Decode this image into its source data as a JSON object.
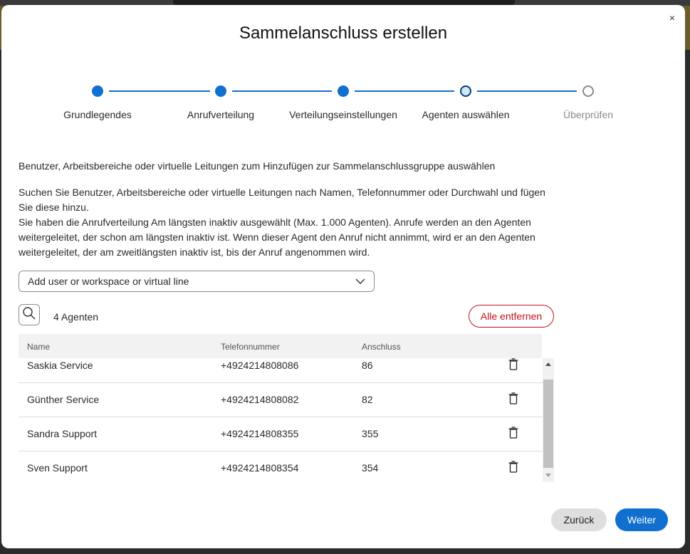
{
  "dialog": {
    "title": "Sammelanschluss erstellen",
    "close_glyph": "×"
  },
  "stepper": {
    "steps": [
      {
        "label": "Grundlegendes",
        "state": "done"
      },
      {
        "label": "Anrufverteilung",
        "state": "done"
      },
      {
        "label": "Verteilungseinstellungen",
        "state": "done"
      },
      {
        "label": "Agenten auswählen",
        "state": "current"
      },
      {
        "label": "Überprüfen",
        "state": "future"
      }
    ]
  },
  "content": {
    "intro": "Benutzer, Arbeitsbereiche oder virtuelle Leitungen zum Hinzufügen zur Sammelanschlussgruppe auswählen",
    "instructions_line1": "Suchen Sie Benutzer, Arbeitsbereiche oder virtuelle Leitungen nach Namen, Telefonnummer oder Durchwahl und fügen Sie diese hinzu.",
    "instructions_line2": "Sie haben die Anrufverteilung Am längsten inaktiv ausgewählt (Max. 1.000 Agenten). Anrufe werden an den Agenten weitergeleitet, der schon am längsten inaktiv ist. Wenn dieser Agent den Anruf nicht annimmt, wird er an den Agenten weitergeleitet, der am zweitlängsten inaktiv ist, bis der Anruf angenommen wird.",
    "dropdown_placeholder": "Add user or workspace or virtual line",
    "agent_count": "4 Agenten",
    "remove_all_label": "Alle entfernen"
  },
  "table": {
    "columns": [
      "Name",
      "Telefonnummer",
      "Anschluss"
    ],
    "rows": [
      {
        "name": "Saskia Service",
        "phone": "+4924214808086",
        "ext": "86"
      },
      {
        "name": "Günther Service",
        "phone": "+4924214808082",
        "ext": "82"
      },
      {
        "name": "Sandra Support",
        "phone": "+4924214808355",
        "ext": "355"
      },
      {
        "name": "Sven Support",
        "phone": "+4924214808354",
        "ext": "354"
      }
    ]
  },
  "footer": {
    "back_label": "Zurück",
    "next_label": "Weiter"
  },
  "colors": {
    "accent": "#1170cf",
    "danger": "#c1121f"
  }
}
